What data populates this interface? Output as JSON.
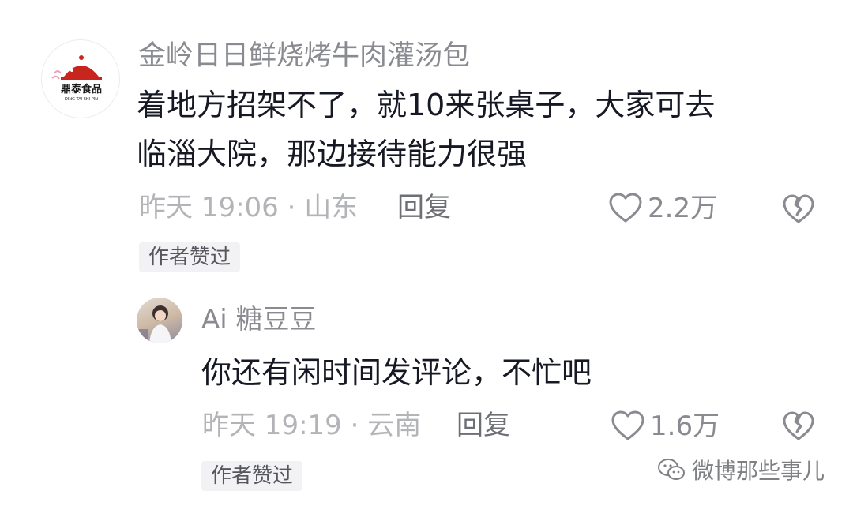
{
  "comments": [
    {
      "username": "金岭日日鲜烧烤牛肉灌汤包",
      "avatar_logo_text": "鼎泰食品",
      "avatar_logo_sub": "DING TAI SHI PIN",
      "text_line_1": "着地方招架不了，就10来张桌子，大家可去",
      "text_line_2": "临淄大院，那边接待能力很强",
      "meta": "昨天 19:06 · 山东",
      "reply_label": "回复",
      "likes": "2.2万",
      "badge": "作者赞过"
    },
    {
      "username": "Ai 糖豆豆",
      "text": "你还有闲时间发评论，不忙吧",
      "meta": "昨天 19:19 · 云南",
      "reply_label": "回复",
      "likes": "1.6万",
      "badge": "作者赞过"
    }
  ],
  "watermark": {
    "text": "微博那些事儿",
    "icon": "wechat-icon"
  },
  "colors": {
    "text": "#161823",
    "secondary": "#8a8b91",
    "meta": "#b3b4b8",
    "logo_red": "#c8251f"
  }
}
